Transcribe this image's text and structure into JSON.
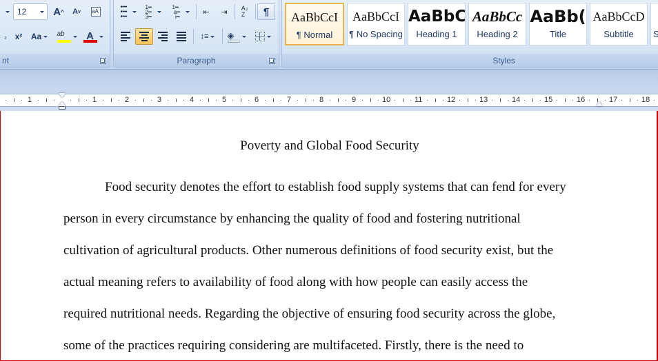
{
  "ribbon": {
    "font": {
      "size_value": "12",
      "grow_font_icon": "A",
      "shrink_font_icon": "A",
      "subscript_label": "x",
      "superscript_label": "x²",
      "change_case_label": "Aa",
      "highlight_label": "ab",
      "font_color_label": "A",
      "group_label_partial": "nt",
      "highlight_color": "#ffff00",
      "font_color_bar": "#e00000"
    },
    "paragraph": {
      "group_label": "Paragraph",
      "show_marks_label": "¶"
    },
    "styles": {
      "group_label": "Styles",
      "tiles": [
        {
          "sample": "AaBbCcI",
          "name": "¶ Normal"
        },
        {
          "sample": "AaBbCcI",
          "name": "¶ No Spacing"
        },
        {
          "sample": "AaBbC",
          "name": "Heading 1"
        },
        {
          "sample": "AaBbCc",
          "name": "Heading 2"
        },
        {
          "sample": "AaBb(",
          "name": "Title"
        },
        {
          "sample": "AaBbCcD",
          "name": "Subtitle"
        },
        {
          "sample": "",
          "name": "S"
        }
      ]
    }
  },
  "ruler": {
    "numbers": [
      "1",
      "1",
      "2",
      "3",
      "4",
      "5",
      "6",
      "7",
      "8",
      "9",
      "10",
      "11",
      "12",
      "13",
      "14",
      "15",
      "16",
      "17",
      "18"
    ]
  },
  "document": {
    "title": "Poverty and Global Food Security",
    "lines": [
      "Food security denotes the effort to establish food supply systems that can fend for every",
      "person in every circumstance by enhancing the quality of food and fostering nutritional",
      "cultivation of agricultural products. Other numerous definitions of food security exist, but the",
      "actual meaning refers to availability of food along with how people can easily access the",
      "required nutritional needs. Regarding the objective of ensuring food security across the globe,",
      "some of the practices requiring considering are multifaceted. Firstly, there is the need to"
    ]
  }
}
